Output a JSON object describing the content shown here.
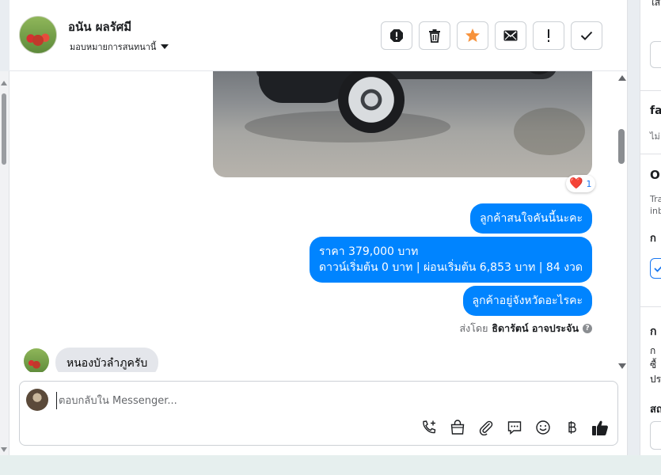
{
  "header": {
    "contact_name": "อนัน ผลรัศมี",
    "assign_label": "มอบหมายการสนทนานี้"
  },
  "actions": [
    {
      "name": "report-spam-icon"
    },
    {
      "name": "trash-icon"
    },
    {
      "name": "star-icon"
    },
    {
      "name": "mail-icon"
    },
    {
      "name": "exclamation-icon"
    },
    {
      "name": "check-icon"
    }
  ],
  "conversation": {
    "reaction": {
      "emoji": "❤️",
      "count": "1"
    },
    "outgoing": [
      "ลูกค้าสนใจคันนี้นะคะ",
      "ราคา 379,000 บาท",
      "ดาวน์เริ่มต้น 0 บาท | ผ่อนเริ่มต้น 6,853 บาท | 84 งวด",
      "ลูกค้าอยู่จังหวัดอะไรคะ"
    ],
    "sent_by_label": "ส่งโดย",
    "sent_by_name": "ธิดารัตน์ อาจประจัน",
    "incoming": "หนองบัวลำภูครับ"
  },
  "composer": {
    "placeholder": "ตอบกลับใน Messenger..."
  },
  "side_panel": {
    "t1": "ใส่",
    "t2": "fa",
    "t3": "ไม่",
    "t4": "O",
    "t5": "Tra",
    "t6": "inb",
    "t7": "ก",
    "t8": "ก",
    "t9": "ก",
    "t10": "ซื้",
    "t11": "ปร",
    "t12": "สถ"
  },
  "colors": {
    "accent": "#0084ff",
    "star": "#f7923b",
    "heart": "#e41e3f"
  }
}
